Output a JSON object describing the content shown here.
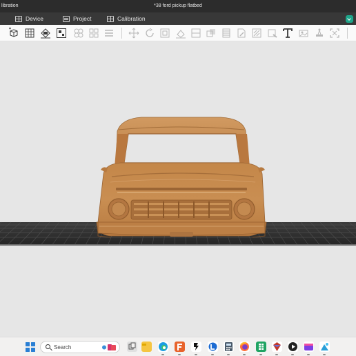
{
  "titlebar": {
    "left_text": "libration",
    "title": "*38 ford pickup flatbed"
  },
  "tabs": [
    {
      "label": "Device",
      "icon": "device-icon"
    },
    {
      "label": "Project",
      "icon": "project-icon"
    },
    {
      "label": "Calibration",
      "icon": "calibration-icon"
    }
  ],
  "accent_color": "#1fa58a",
  "toolbar": {
    "icons": [
      "add-object-icon",
      "add-plate-icon",
      "auto-orient-icon",
      "arrange-icon",
      "split-objects-icon",
      "split-parts-icon",
      "layers-icon",
      "move-icon",
      "rotate-icon",
      "scale-icon",
      "lay-on-face-icon",
      "cut-icon",
      "boolean-icon",
      "variable-layer-height-icon",
      "support-paint-icon",
      "seam-paint-icon",
      "color-paint-icon",
      "text-icon",
      "emboss-icon",
      "measure-icon",
      "assembly-icon"
    ]
  },
  "viewport": {
    "model_name": "38 ford pickup flatbed",
    "background": "#e6e6e6",
    "model_color": "#c98a4e"
  },
  "taskbar": {
    "search_placeholder": "Search",
    "apps": [
      "file-explorer-icon",
      "edge-icon",
      "flashforge-icon",
      "slicer-icon",
      "bambu-icon",
      "calculator-icon",
      "firefox-icon",
      "sheets-icon",
      "3d-app-icon",
      "media-player-icon",
      "clipchamp-icon",
      "photos-icon"
    ]
  }
}
